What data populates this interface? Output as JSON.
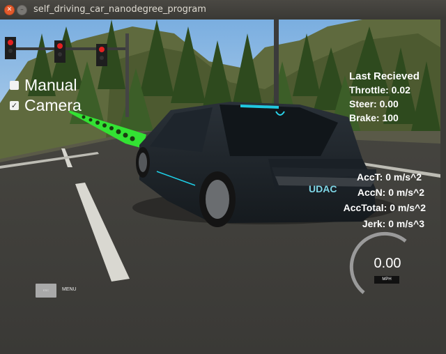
{
  "window": {
    "title": "self_driving_car_nanodegree_program"
  },
  "toggles": [
    {
      "label": "Manual",
      "checked": false
    },
    {
      "label": "Camera",
      "checked": true
    }
  ],
  "telemetry": {
    "header": "Last Recieved",
    "throttle": "Throttle: 0.02",
    "steer": "Steer: 0.00",
    "brake": "Brake: 100"
  },
  "acceleration": {
    "acct": "AccT: 0 m/s^2",
    "accn": "AccN: 0 m/s^2",
    "acctotal": "AccTotal: 0 m/s^2",
    "jerk": "Jerk: 0 m/s^3"
  },
  "speedometer": {
    "value": "0.00",
    "unit": "MPH"
  },
  "menu": {
    "esc_label": "ESC",
    "label": "MENU"
  },
  "car": {
    "brand_text": "UDAC"
  }
}
